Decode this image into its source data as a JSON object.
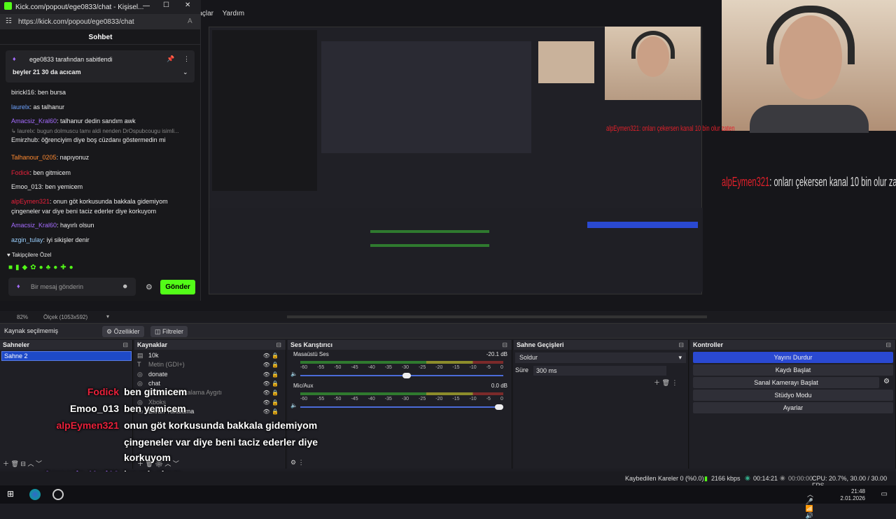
{
  "obs_menu": [
    "raçlar",
    "Yardım"
  ],
  "kick": {
    "title": "Kick.com/popout/ege0833/chat - Kişisel...",
    "url": "https://kick.com/popout/ege0833/chat",
    "chat_header": "Sohbet",
    "pinned_by": "ege0833 tarafından sabitlendi",
    "pinned_msg": "beyler 21 30 da acıcam",
    "lines": [
      {
        "user": "birickl16",
        "color": "#e8e8e8",
        "text": ": ben bursa"
      },
      {
        "user": "laurelx",
        "color": "#6ea3ff",
        "text": ": as talhanur"
      },
      {
        "user": "Amacsiz_Kral60",
        "color": "#a56cff",
        "text": ": talhanur dedin sandım awk"
      },
      {
        "user": "",
        "color": "#888",
        "text": "↳ laurelx: bugun dolmuscu tamı aldi nenden DrOspubcougu isimli..."
      },
      {
        "user": "Emirzhub",
        "color": "#e8e8e8",
        "text": ": öğrenciyim diye boş cüzdanı göstermedin mi"
      },
      {
        "user": "Talhanour_0205",
        "color": "#ff8a30",
        "text": ": napıyonuz"
      },
      {
        "user": "Fodick",
        "color": "#e8203a",
        "text": ": ben gitmicem"
      },
      {
        "user": "Emoo_013",
        "color": "#e8e8e8",
        "text": ": ben yemicem"
      },
      {
        "user": "alpEymen321",
        "color": "#e8203a",
        "text": ": onun göt korkusunda bakkala gidemiyom"
      },
      {
        "user": "",
        "color": "#e8e8e8",
        "text": "çingeneler var diye beni taciz ederler diye korkuyom"
      },
      {
        "user": "Amacsiz_Kral60",
        "color": "#a56cff",
        "text": ": hayırlı olsun"
      },
      {
        "user": "azgin_tulay",
        "color": "#9ad0ff",
        "text": ": iyi sikişler denir"
      }
    ],
    "followers_label": "Takipçilere Özel",
    "input_placeholder": "Bir mesaj gönderin",
    "send_label": "Gönder"
  },
  "overlay": {
    "small_alert": "alpEymen321: onları çekersen kanal 10 bin olur zaten",
    "big_alert_user": "alpEymen321",
    "big_alert_text": ": onları çekersen kanal 10 bin olur zaten"
  },
  "zoom": {
    "level": "82%",
    "scale": "Ölçek (1053x592)"
  },
  "toolbar": {
    "no_source": "Kaynak seçilmemiş",
    "props": "Özellikler",
    "filters": "Filtreler"
  },
  "scenes": {
    "title": "Sahneler",
    "items": [
      "Sahne 2"
    ]
  },
  "sources": {
    "title": "Kaynaklar",
    "items": [
      "10k",
      "Metin (GDI+)",
      "donate",
      "chat",
      "Ses Girişi Yakalama Aygıtı",
      "Xboks",
      "Ekran Yakalama"
    ]
  },
  "audio": {
    "title": "Ses Karıştırıcı",
    "channels": [
      {
        "name": "Masaüstü Ses",
        "db": "-20.1 dB",
        "level": 0.53
      },
      {
        "name": "Mic/Aux",
        "db": "0.0 dB",
        "level": 1.0
      }
    ],
    "scale": [
      "-60",
      "-55",
      "-50",
      "-45",
      "-40",
      "-35",
      "-30",
      "-25",
      "-20",
      "-15",
      "-10",
      "-5",
      "0"
    ]
  },
  "transitions": {
    "title": "Sahne Geçişleri",
    "selected": "Soldur",
    "duration_label": "Süre",
    "duration": "300 ms"
  },
  "controls": {
    "title": "Kontroller",
    "buttons": [
      "Yayını Durdur",
      "Kaydı Başlat",
      "Sanal Kamerayı Başlat",
      "Stüdyo Modu",
      "Ayarlar"
    ]
  },
  "overlay_chat": [
    {
      "user": "Fodick",
      "color": "#e8203a",
      "text": "ben gitmicem"
    },
    {
      "user": "Emoo_013",
      "color": "#ffffff",
      "text": "ben yemicem"
    },
    {
      "user": "alpEymen321",
      "color": "#e8203a",
      "text": "onun göt korkusunda bakkala gidemiyom"
    },
    {
      "user": "",
      "color": "#ffffff",
      "text": "çingeneler var diye beni taciz ederler diye"
    },
    {
      "user": "",
      "color": "#ffffff",
      "text": "korkuyom"
    },
    {
      "user": "Amacsiz_Kral60",
      "color": "#a56cff",
      "text": "hayırlı olsun"
    },
    {
      "user": "azgin_tulay",
      "color": "#a56cff",
      "text": "iyi sikişler denir"
    }
  ],
  "status": {
    "dropped": "Kaybedilen Kareler 0 (%0.0)",
    "bitrate": "2166 kbps",
    "stream_time": "00:14:21",
    "rec_time": "00:00:00",
    "cpu": "CPU: 20.7%, 30.00 / 30.00 FPS"
  },
  "clock": {
    "time": "21:48",
    "date": "2.01.2026"
  }
}
